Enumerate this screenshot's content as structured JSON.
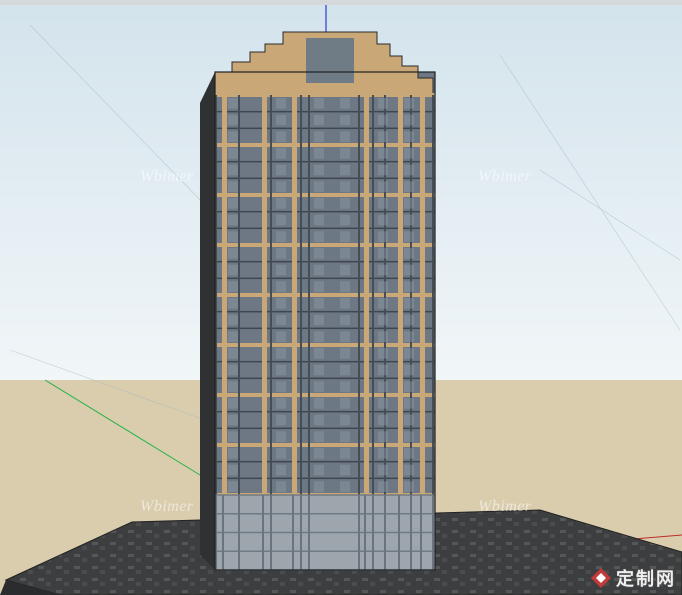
{
  "watermarks": [
    "Wbimer",
    "Wbimer",
    "Wbimer",
    "Wbimer"
  ],
  "logo_text": "定制网",
  "colors": {
    "sky_top": "#dbe8ef",
    "sky_bottom": "#eef5f8",
    "ground": "#d8ccac",
    "base_plate": "#3f4142",
    "facade_frame": "#c9a777",
    "glass": "#6c7883",
    "podium": "#9ea6ad",
    "axis_blue": "#2b3bd6",
    "axis_green": "#29b34a",
    "axis_red": "#c02b2b",
    "logo_red": "#c23b3b"
  },
  "model": {
    "description_icon": "building-icon",
    "floors": 24
  }
}
